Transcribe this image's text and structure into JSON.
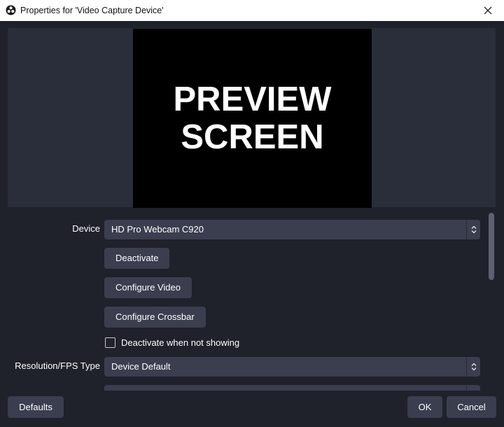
{
  "window": {
    "title": "Properties for 'Video Capture Device'",
    "close_icon": "close-icon",
    "app_icon": "obs-logo-icon"
  },
  "preview": {
    "text": "PREVIEW\nSCREEN"
  },
  "form": {
    "device": {
      "label": "Device",
      "value": "HD Pro Webcam C920"
    },
    "deactivate_label": "Deactivate",
    "configure_video_label": "Configure Video",
    "configure_crossbar_label": "Configure Crossbar",
    "deactivate_when_not_showing": {
      "label": "Deactivate when not showing",
      "checked": false
    },
    "resolution_fps_type": {
      "label": "Resolution/FPS Type",
      "value": "Device Default"
    }
  },
  "footer": {
    "defaults_label": "Defaults",
    "ok_label": "OK",
    "cancel_label": "Cancel"
  },
  "colors": {
    "background": "#1f212b",
    "control": "#3b3e4f",
    "preview_frame": "#2a2d3a",
    "titlebar": "#ffffff"
  }
}
